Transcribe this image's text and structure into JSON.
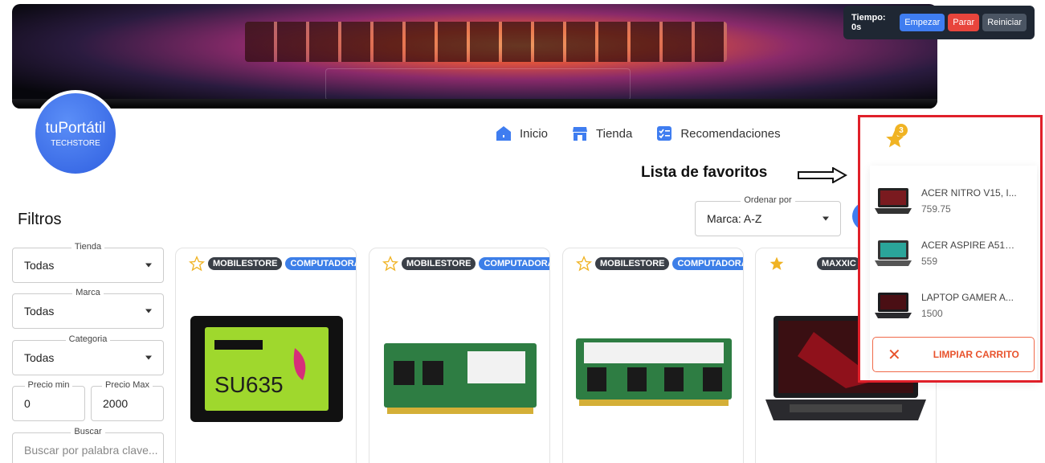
{
  "timer": {
    "label": "Tiempo: 0s",
    "start": "Empezar",
    "stop": "Parar",
    "reset": "Reiniciar"
  },
  "logo": {
    "name": "tuPortátil",
    "sub": "TECHSTORE"
  },
  "nav": [
    {
      "label": "Inicio",
      "icon": "home-icon"
    },
    {
      "label": "Tienda",
      "icon": "store-icon"
    },
    {
      "label": "Recomendaciones",
      "icon": "checklist-icon"
    }
  ],
  "annotation": "Lista de favoritos",
  "filters": {
    "title": "Filtros",
    "tienda": {
      "label": "Tienda",
      "value": "Todas"
    },
    "marca": {
      "label": "Marca",
      "value": "Todas"
    },
    "categoria": {
      "label": "Categoria",
      "value": "Todas"
    },
    "precio_min": {
      "label": "Precio min",
      "value": "0"
    },
    "precio_max": {
      "label": "Precio Max",
      "value": "2000"
    },
    "buscar": {
      "label": "Buscar",
      "placeholder": "Buscar por palabra clave..."
    }
  },
  "sort": {
    "label": "Ordenar por",
    "value": "Marca: A-Z"
  },
  "products": [
    {
      "store": "MOBILESTORE",
      "category": "COMPUTADORA",
      "favorite": false,
      "image": "ssd-adata-su635"
    },
    {
      "store": "MOBILESTORE",
      "category": "COMPUTADORA",
      "favorite": false,
      "image": "ram-adata-sodimm"
    },
    {
      "store": "MOBILESTORE",
      "category": "COMPUTADORA",
      "favorite": false,
      "image": "ram-adata-sodimm"
    },
    {
      "store": "MAXXIC",
      "category": "",
      "favorite": true,
      "image": "laptop-acer-nitro"
    }
  ],
  "favorites": {
    "count": "3",
    "items": [
      {
        "name": "ACER NITRO V15, I...",
        "price": "759.75"
      },
      {
        "name": "ACER ASPIRE A515...",
        "price": "559"
      },
      {
        "name": "LAPTOP GAMER A...",
        "price": "1500"
      }
    ],
    "clear_label": "LIMPIAR CARRITO"
  },
  "colors": {
    "accent": "#3f7df0",
    "danger": "#e8453c",
    "highlight": "#e0202a",
    "star": "#f0b323"
  }
}
